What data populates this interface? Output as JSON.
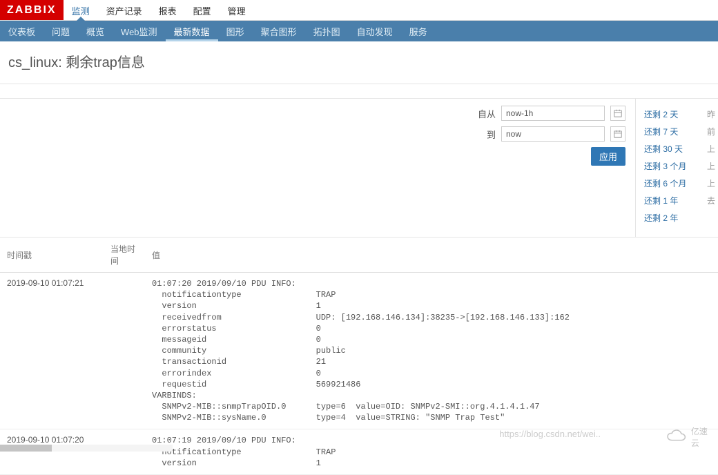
{
  "brand": "ZABBIX",
  "topnav": [
    "监测",
    "资产记录",
    "报表",
    "配置",
    "管理"
  ],
  "topnav_active": 0,
  "subnav": [
    "仪表板",
    "问题",
    "概览",
    "Web监测",
    "最新数据",
    "图形",
    "聚合图形",
    "拓扑图",
    "自动发现",
    "服务"
  ],
  "subnav_active": 4,
  "page_title": "cs_linux: 剩余trap信息",
  "filter": {
    "from_label": "自从",
    "from_value": "now-1h",
    "to_label": "到",
    "to_value": "now",
    "apply_label": "应用"
  },
  "quick_links": [
    {
      "l": "还剩 2 天",
      "r": "昨"
    },
    {
      "l": "还剩 7 天",
      "r": "前"
    },
    {
      "l": "还剩 30 天",
      "r": "上"
    },
    {
      "l": "还剩 3 个月",
      "r": "上"
    },
    {
      "l": "还剩 6 个月",
      "r": "上"
    },
    {
      "l": "还剩 1 年",
      "r": "去"
    },
    {
      "l": "还剩 2 年",
      "r": ""
    }
  ],
  "columns": {
    "ts": "时间戳",
    "lt": "当地时间",
    "val": "值"
  },
  "rows": [
    {
      "ts": "2019-09-10 01:07:21",
      "lt": "",
      "value": "01:07:20 2019/09/10 PDU INFO:\n  notificationtype               TRAP\n  version                        1\n  receivedfrom                   UDP: [192.168.146.134]:38235->[192.168.146.133]:162\n  errorstatus                    0\n  messageid                      0\n  community                      public\n  transactionid                  21\n  errorindex                     0\n  requestid                      569921486\nVARBINDS:\n  SNMPv2-MIB::snmpTrapOID.0      type=6  value=OID: SNMPv2-SMI::org.4.1.4.1.47\n  SNMPv2-MIB::sysName.0          type=4  value=STRING: \"SNMP Trap Test\""
    },
    {
      "ts": "2019-09-10 01:07:20",
      "lt": "",
      "value": "01:07:19 2019/09/10 PDU INFO:\n  notificationtype               TRAP\n  version                        1"
    }
  ],
  "watermark": "https://blog.csdn.net/wei..",
  "cloud_text": "亿速云"
}
